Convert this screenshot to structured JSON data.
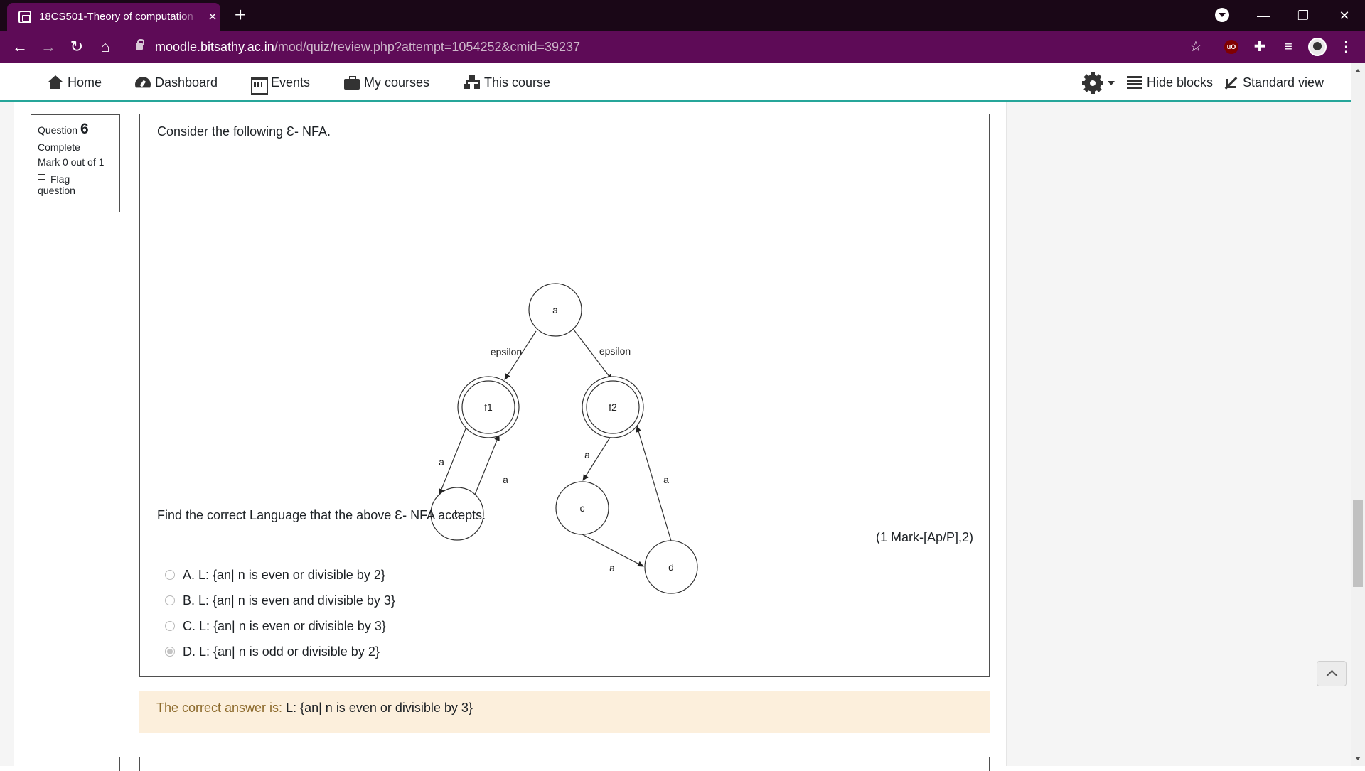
{
  "browser": {
    "tab_title": "18CS501-Theory of computation",
    "url_host": "moodle.bitsathy.ac.in",
    "url_path": "/mod/quiz/review.php?attempt=1054252&cmid=39237",
    "ublock_label": "uO"
  },
  "navbar": {
    "items": [
      {
        "label": "Home",
        "icon": "home-icon"
      },
      {
        "label": "Dashboard",
        "icon": "dashboard-icon"
      },
      {
        "label": "Events",
        "icon": "calendar-icon"
      },
      {
        "label": "My courses",
        "icon": "briefcase-icon"
      },
      {
        "label": "This course",
        "icon": "sitemap-icon"
      }
    ],
    "hide_blocks": "Hide blocks",
    "standard_view": "Standard view"
  },
  "question_info": {
    "question_label": "Question",
    "question_number": "6",
    "state": "Complete",
    "mark": "Mark 0 out of 1",
    "flag_line1": "Flag",
    "flag_line2": "question"
  },
  "question": {
    "intro": "Consider the following Ɛ- NFA.",
    "prompt": "Find the correct Language that the above Ɛ- NFA accepts.",
    "mark_ref": "(1 Mark-[Ap/P],2)",
    "options": [
      {
        "label": "A. L: {an| n is even or divisible by 2}",
        "selected": false
      },
      {
        "label": "B. L: {an| n is even and divisible by 3}",
        "selected": false
      },
      {
        "label": "C. L: {an| n is even or divisible by 3}",
        "selected": false
      },
      {
        "label": "D. L: {an| n is odd or divisible by 2}",
        "selected": true
      }
    ]
  },
  "diagram": {
    "states": [
      "a",
      "f1",
      "f2",
      "b",
      "c",
      "d"
    ],
    "accepting_states": [
      "f1",
      "f2"
    ],
    "edge_labels": {
      "a_f1": "epsilon",
      "a_f2": "epsilon",
      "f1_b": "a",
      "b_f1": "a",
      "f2_c": "a",
      "c_d": "a",
      "d_f2": "a"
    }
  },
  "feedback": {
    "label": "The correct answer is:",
    "answer": "L: {an| n is even or divisible by 3}"
  },
  "colors": {
    "chrome": "#5e0b57",
    "tabstrip": "#1a0717",
    "accent": "#26a69a",
    "feedback_bg": "#fcefdc"
  }
}
